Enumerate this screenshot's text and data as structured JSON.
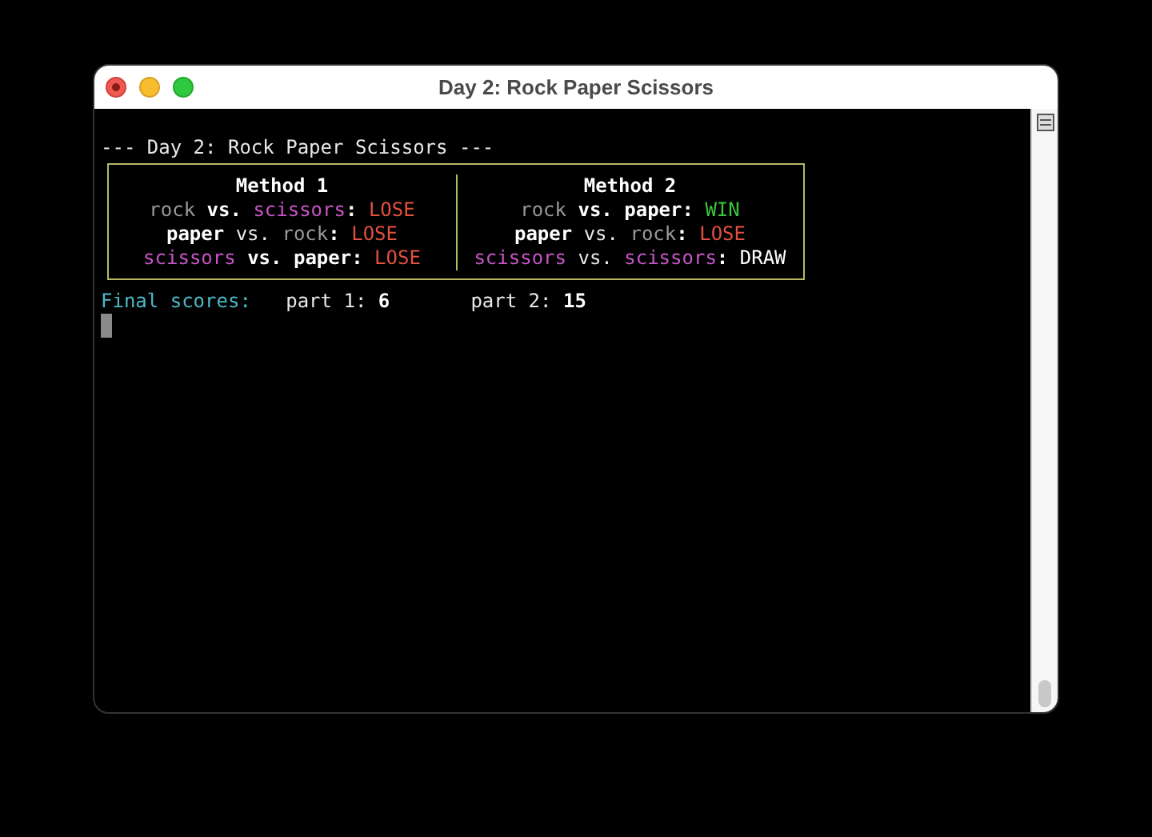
{
  "window": {
    "title": "Day 2: Rock Paper Scissors"
  },
  "heading": "--- Day 2: Rock Paper Scissors ---",
  "methods": [
    {
      "title": "Method 1",
      "lines": [
        [
          {
            "text": "rock",
            "kind": "dim"
          },
          {
            "text": "vs.",
            "kind": "bold"
          },
          {
            "text": "scissors",
            "kind": "magenta"
          },
          {
            "text": ":",
            "kind": "colon"
          },
          {
            "text": "LOSE",
            "kind": "lose"
          }
        ],
        [
          {
            "text": "paper",
            "kind": "bold"
          },
          {
            "text": "vs.",
            "kind": "plain"
          },
          {
            "text": "rock",
            "kind": "dim"
          },
          {
            "text": ":",
            "kind": "colon"
          },
          {
            "text": "LOSE",
            "kind": "lose"
          }
        ],
        [
          {
            "text": "scissors",
            "kind": "magenta"
          },
          {
            "text": "vs.",
            "kind": "bold"
          },
          {
            "text": "paper",
            "kind": "bold"
          },
          {
            "text": ":",
            "kind": "colon"
          },
          {
            "text": "LOSE",
            "kind": "lose"
          }
        ]
      ]
    },
    {
      "title": "Method 2",
      "lines": [
        [
          {
            "text": "rock",
            "kind": "dim"
          },
          {
            "text": "vs.",
            "kind": "bold"
          },
          {
            "text": "paper",
            "kind": "bold"
          },
          {
            "text": ":",
            "kind": "colon"
          },
          {
            "text": "WIN",
            "kind": "win"
          }
        ],
        [
          {
            "text": "paper",
            "kind": "bold"
          },
          {
            "text": "vs.",
            "kind": "plain"
          },
          {
            "text": "rock",
            "kind": "dim"
          },
          {
            "text": ":",
            "kind": "colon"
          },
          {
            "text": "LOSE",
            "kind": "lose"
          }
        ],
        [
          {
            "text": "scissors",
            "kind": "magenta"
          },
          {
            "text": "vs.",
            "kind": "plain"
          },
          {
            "text": "scissors",
            "kind": "magenta"
          },
          {
            "text": ":",
            "kind": "colon"
          },
          {
            "text": "DRAW",
            "kind": "draw"
          }
        ]
      ]
    }
  ],
  "scores": {
    "label": "Final scores:",
    "parts": [
      {
        "label": "part 1:",
        "value": "6"
      },
      {
        "label": "part 2:",
        "value": "15"
      }
    ]
  }
}
